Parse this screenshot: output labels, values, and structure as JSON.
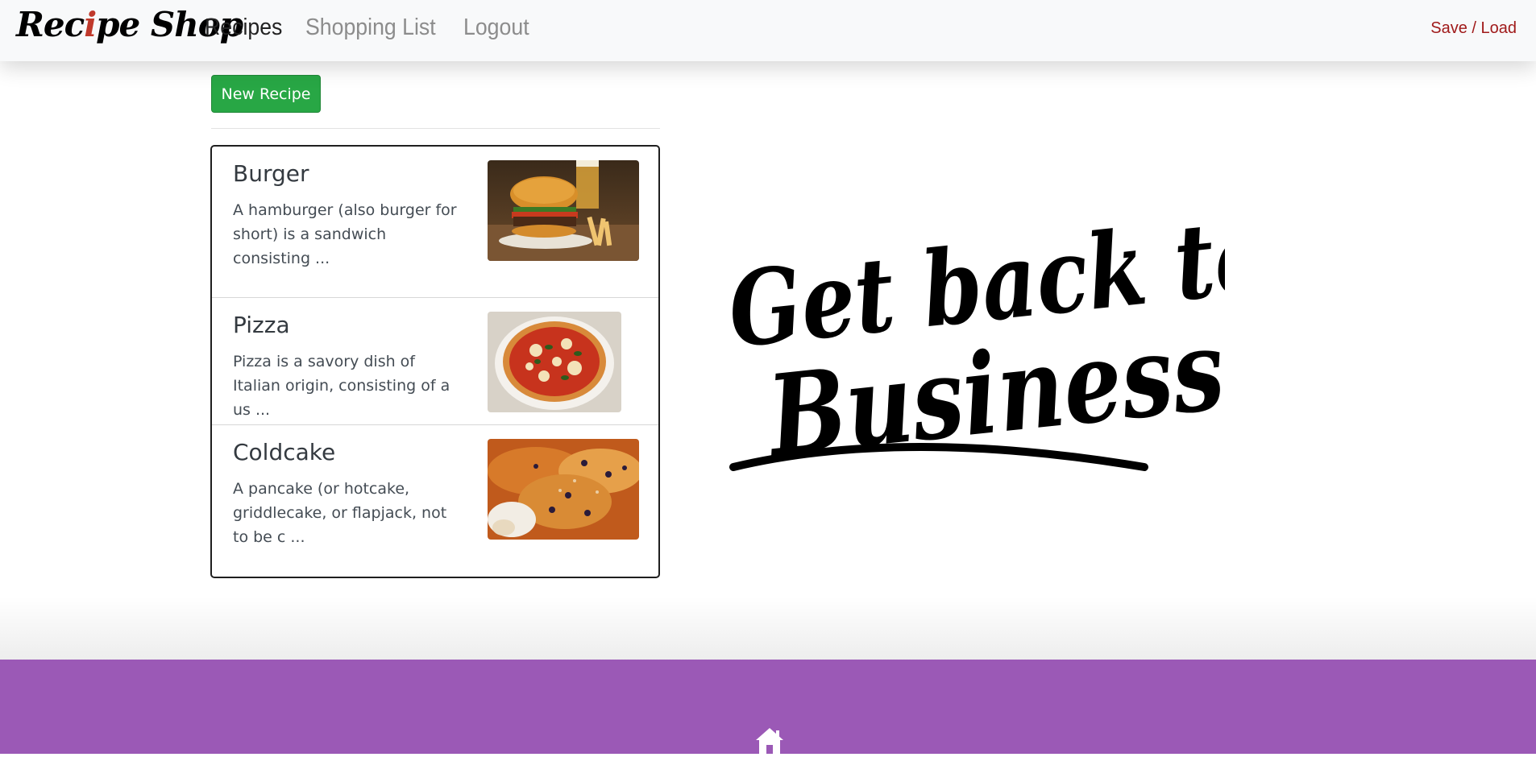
{
  "navbar": {
    "brand_part1": "Rec",
    "brand_red": "i",
    "brand_part2": "pe Shop",
    "links": [
      {
        "label": "Recipes",
        "active": true
      },
      {
        "label": "Shopping List",
        "active": false
      },
      {
        "label": "Logout",
        "active": false
      }
    ],
    "save_load": "Save / Load"
  },
  "actions": {
    "new_recipe": "New Recipe"
  },
  "recipes": [
    {
      "name": "Burger",
      "description": "A hamburger (also burger for short) is a sandwich consisting ..."
    },
    {
      "name": "Pizza",
      "description": "Pizza is a savory dish of Italian origin, consisting of a us ..."
    },
    {
      "name": "Coldcake",
      "description": "A pancake (or hotcake, griddlecake, or flapjack, not to be c ..."
    }
  ],
  "hero": {
    "line1": "Get back to",
    "line2": "Business!"
  },
  "colors": {
    "success": "#28a745",
    "footer": "#9b59b6",
    "save_load": "#a01a1a"
  },
  "footer": {
    "icon": "home-icon"
  }
}
